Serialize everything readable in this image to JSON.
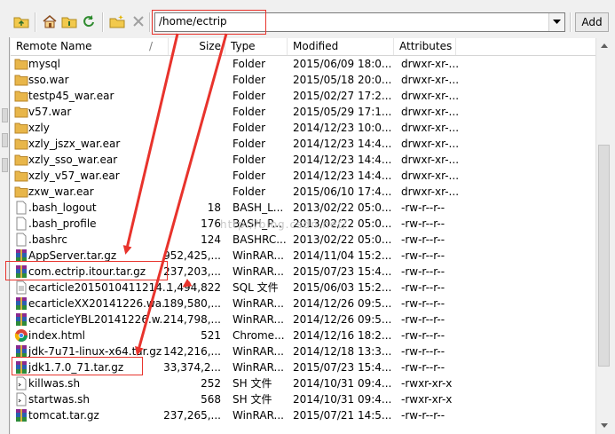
{
  "toolbar": {
    "path_value": "/home/ectrip",
    "add_label": "Add",
    "buttons": [
      {
        "name": "parent-directory-icon"
      },
      {
        "name": "home-icon"
      },
      {
        "name": "root-icon"
      },
      {
        "name": "refresh-icon"
      },
      {
        "name": "new-folder-icon"
      },
      {
        "name": "delete-icon"
      }
    ]
  },
  "columns": {
    "name": "Remote Name",
    "size": "Size",
    "type": "Type",
    "modified": "Modified",
    "attributes": "Attributes",
    "sort_indicator": "/"
  },
  "files": [
    {
      "name": "mysql",
      "size": "",
      "type": "Folder",
      "modified": "2015/06/09 18:0...",
      "attributes": "drwxr-xr-...",
      "icon": "folder-icon"
    },
    {
      "name": "sso.war",
      "size": "",
      "type": "Folder",
      "modified": "2015/05/18 20:0...",
      "attributes": "drwxr-xr-...",
      "icon": "folder-icon"
    },
    {
      "name": "testp45_war.ear",
      "size": "",
      "type": "Folder",
      "modified": "2015/02/27 17:2...",
      "attributes": "drwxr-xr-...",
      "icon": "folder-icon"
    },
    {
      "name": "v57.war",
      "size": "",
      "type": "Folder",
      "modified": "2015/05/29 17:1...",
      "attributes": "drwxr-xr-...",
      "icon": "folder-icon"
    },
    {
      "name": "xzly",
      "size": "",
      "type": "Folder",
      "modified": "2014/12/23 10:0...",
      "attributes": "drwxr-xr-...",
      "icon": "folder-icon"
    },
    {
      "name": "xzly_jszx_war.ear",
      "size": "",
      "type": "Folder",
      "modified": "2014/12/23 14:4...",
      "attributes": "drwxr-xr-...",
      "icon": "folder-icon"
    },
    {
      "name": "xzly_sso_war.ear",
      "size": "",
      "type": "Folder",
      "modified": "2014/12/23 14:4...",
      "attributes": "drwxr-xr-...",
      "icon": "folder-icon"
    },
    {
      "name": "xzly_v57_war.ear",
      "size": "",
      "type": "Folder",
      "modified": "2014/12/23 14:4...",
      "attributes": "drwxr-xr-...",
      "icon": "folder-icon"
    },
    {
      "name": "zxw_war.ear",
      "size": "",
      "type": "Folder",
      "modified": "2015/06/10 17:4...",
      "attributes": "drwxr-xr-...",
      "icon": "folder-icon"
    },
    {
      "name": ".bash_logout",
      "size": "18",
      "type": "BASH_L...",
      "modified": "2013/02/22 05:0...",
      "attributes": "-rw-r--r--",
      "icon": "blank-file-icon"
    },
    {
      "name": ".bash_profile",
      "size": "176",
      "type": "BASH_P...",
      "modified": "2013/02/22 05:0...",
      "attributes": "-rw-r--r--",
      "icon": "blank-file-icon"
    },
    {
      "name": ".bashrc",
      "size": "124",
      "type": "BASHRC...",
      "modified": "2013/02/22 05:0...",
      "attributes": "-rw-r--r--",
      "icon": "blank-file-icon"
    },
    {
      "name": "AppServer.tar.gz",
      "size": "952,425,...",
      "type": "WinRAR...",
      "modified": "2014/11/04 15:2...",
      "attributes": "-rw-r--r--",
      "icon": "winrar-archive-icon"
    },
    {
      "name": "com.ectrip.itour.tar.gz",
      "size": "237,203,...",
      "type": "WinRAR...",
      "modified": "2015/07/23 15:4...",
      "attributes": "-rw-r--r--",
      "icon": "winrar-archive-icon"
    },
    {
      "name": "ecarticle2015010411214...",
      "size": "1,494,822",
      "type": "SQL 文件",
      "modified": "2015/06/03 15:2...",
      "attributes": "-rw-r--r--",
      "icon": "sql-file-icon"
    },
    {
      "name": "ecarticleXX20141226.wa...",
      "size": "189,580,...",
      "type": "WinRAR...",
      "modified": "2014/12/26 09:5...",
      "attributes": "-rw-r--r--",
      "icon": "winrar-archive-icon"
    },
    {
      "name": "ecarticleYBL20141226.w...",
      "size": "214,798,...",
      "type": "WinRAR...",
      "modified": "2014/12/26 09:5...",
      "attributes": "-rw-r--r--",
      "icon": "winrar-archive-icon"
    },
    {
      "name": "index.html",
      "size": "521",
      "type": "Chrome...",
      "modified": "2014/12/16 18:2...",
      "attributes": "-rw-r--r--",
      "icon": "chrome-html-icon"
    },
    {
      "name": "jdk-7u71-linux-x64.tar.gz",
      "size": "142,216,...",
      "type": "WinRAR...",
      "modified": "2014/12/18 13:3...",
      "attributes": "-rw-r--r--",
      "icon": "winrar-archive-icon"
    },
    {
      "name": "jdk1.7.0_71.tar.gz",
      "size": "33,374,2...",
      "type": "WinRAR...",
      "modified": "2015/07/23 15:4...",
      "attributes": "-rw-r--r--",
      "icon": "winrar-archive-icon"
    },
    {
      "name": "killwas.sh",
      "size": "252",
      "type": "SH 文件",
      "modified": "2014/10/31 09:4...",
      "attributes": "-rwxr-xr-x",
      "icon": "shell-script-icon"
    },
    {
      "name": "startwas.sh",
      "size": "568",
      "type": "SH 文件",
      "modified": "2014/10/31 09:4...",
      "attributes": "-rwxr-xr-x",
      "icon": "shell-script-icon"
    },
    {
      "name": "tomcat.tar.gz",
      "size": "237,265,...",
      "type": "WinRAR...",
      "modified": "2015/07/21 14:5...",
      "attributes": "-rw-r--r--",
      "icon": "winrar-archive-icon"
    }
  ],
  "watermark": "http://blog.csdn.net/",
  "colors": {
    "annotation": "#e8332c",
    "folder": "#e8b64a"
  }
}
